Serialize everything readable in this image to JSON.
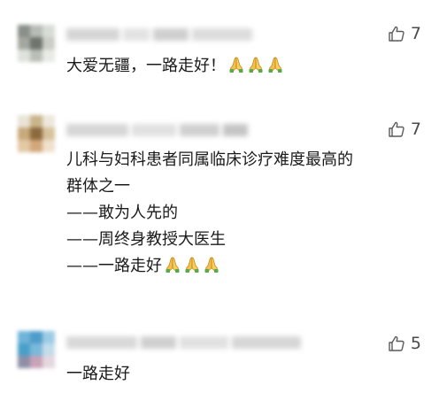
{
  "comments": [
    {
      "like_count": "7",
      "lines": [
        "大爱无疆，一路走好！"
      ],
      "emoji_count": 3,
      "emoji_icon": "folded-hands-icon"
    },
    {
      "like_count": "7",
      "lines": [
        "儿科与妇科患者同属临床诊疗难度最高的",
        "群体之一",
        "——敢为人先的",
        "——周终身教授大医生",
        "——一路走好"
      ],
      "emoji_count": 3,
      "emoji_icon": "folded-hands-icon"
    },
    {
      "like_count": "5",
      "lines": [
        "一路走好"
      ],
      "emoji_count": 0
    }
  ],
  "icons": {
    "like": "thumbs-up-icon"
  },
  "colors": {
    "text": "#1a1a1a",
    "like_icon": "#5a5a5a",
    "background": "#ffffff"
  }
}
